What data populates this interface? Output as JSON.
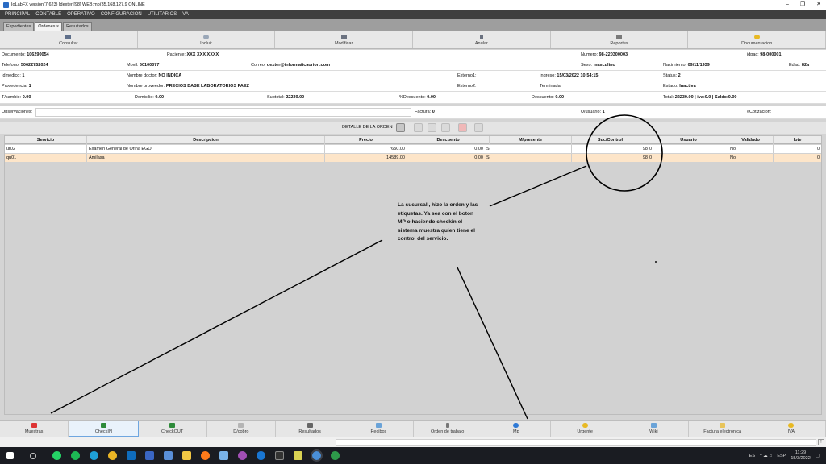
{
  "window": {
    "title": "IoLabFX version(7.623)  [dexter][98] WEB:mp(35.168.127.9 ONLINE"
  },
  "menu": [
    "PRINCIPAL",
    "CONTABLE",
    "OPERATIVO",
    "CONFIGURACION",
    "UTILITARIOS",
    "VA"
  ],
  "tabs": [
    "Expedientes",
    "Ordenes ×",
    "Resultados"
  ],
  "toolbar": [
    {
      "label": "Consultar",
      "icon": "binoculars-icon",
      "color": "#5f6f8a"
    },
    {
      "label": "Incluir",
      "icon": "sun-icon",
      "color": "#9aa7b8"
    },
    {
      "label": "Modificar",
      "icon": "edit-icon",
      "color": "#6b7280"
    },
    {
      "label": "Anular",
      "icon": "pen-icon",
      "color": "#6b7280"
    },
    {
      "label": "Reportes",
      "icon": "printer-icon",
      "color": "#7a7a7a"
    },
    {
      "label": "Documentacion",
      "icon": "smiley-icon",
      "color": "#e8b923"
    }
  ],
  "info": {
    "documento_label": "Documento:",
    "documento": "106290054",
    "paciente_label": "Paciente:",
    "paciente": "XXX XXX XXXX",
    "numero_label": "Numero:",
    "numero": "98-220300003",
    "idpac_label": "idpac:",
    "idpac": "98-000001",
    "telefono_label": "Telefono:",
    "telefono": "50622752024",
    "movil_label": "Movil:",
    "movil": "60100077",
    "correo_label": "Correo:",
    "correo": "dexter@informaticaorion.com",
    "sexo_label": "Sexo:",
    "sexo": "masculino",
    "nacimiento_label": "Nacimiento:",
    "nacimiento": "09/11/1939",
    "edad_label": "Edad:",
    "edad": "82a",
    "idmedico_label": "Idmedico:",
    "idmedico": "1",
    "doctor_label": "Nombre doctor:",
    "doctor": "NO INDICA",
    "externo1_label": "Externo1:",
    "ingreso_label": "Ingreso:",
    "ingreso": "15/03/2022 10:54:15",
    "status_label": "Status:",
    "status": "2",
    "procedencia_label": "Procedencia:",
    "procedencia": "1",
    "proveedor_label": "Nombre proveedor:",
    "proveedor": "PRECIOS BASE LABORATORIOS PAEZ",
    "externo2_label": "Externo2:",
    "terminada_label": "Terminada:",
    "estado_label": "Estado:",
    "estado": "Inactiva",
    "tcambio_label": "T/cambio:",
    "tcambio": "0.00",
    "domicilio_label": "Domicilio:",
    "domicilio": "0.00",
    "subtotal_label": "Subtotal:",
    "subtotal": "22239.00",
    "pdesc_label": "%Descuento:",
    "pdesc": "0.00",
    "descuento_label": "Descuento:",
    "descuento": "0.00",
    "total_label": "Total:",
    "total": "22239.00",
    "iva": "| iva:0.0",
    "saldo": "| Saldo:0.00",
    "observaciones_label": "Observaciones:",
    "factura_label": "Factura:",
    "factura": "0",
    "uusuario_label": "U/usuario:",
    "uusuario": "1",
    "cotizacion_label": "#Cotizacion:"
  },
  "detalle": {
    "title": "DETALLE DE LA ORDEN"
  },
  "grid": {
    "headers": [
      "Servicio",
      "Descripcion",
      "Precio",
      "Descuento",
      "M/presente",
      "Suc/Control",
      "Usuario",
      "Validado",
      "lote"
    ],
    "rows": [
      [
        "ur02",
        "Examen General de Orina EGO",
        "7650.00",
        "0.00",
        "Si",
        "98",
        "0",
        "",
        "No",
        "0"
      ],
      [
        "qu01",
        "Amilasa",
        "14589.00",
        "0.00",
        "Si",
        "98",
        "0",
        "",
        "No",
        "0"
      ]
    ]
  },
  "annotation": {
    "note": "La sucursal , hizo la orden y las etiquetas. Ya sea con el boton MP o haciendo checkin el sistema muestra quien tiene el control del servicio."
  },
  "bottom": [
    {
      "label": "Muestras",
      "icon": "samples-icon",
      "color": "#d33"
    },
    {
      "label": "CheckIN",
      "icon": "arrow-left-icon",
      "color": "#2e8b3a"
    },
    {
      "label": "CheckOUT",
      "icon": "arrow-right-icon",
      "color": "#2e8b3a"
    },
    {
      "label": "D/cobro",
      "icon": "document-icon",
      "color": "#b5b5b5"
    },
    {
      "label": "Resultados",
      "icon": "results-icon",
      "color": "#666"
    },
    {
      "label": "Recibos",
      "icon": "receipt-icon",
      "color": "#6aa3d8"
    },
    {
      "label": "Orden de trabajo",
      "icon": "pen-icon",
      "color": "#777"
    },
    {
      "label": "Mp",
      "icon": "info-icon",
      "color": "#2f7ad6"
    },
    {
      "label": "Urgente",
      "icon": "smiley-icon",
      "color": "#e8b923"
    },
    {
      "label": "Wiki",
      "icon": "wiki-icon",
      "color": "#6aa3d8"
    },
    {
      "label": "Factura electronica",
      "icon": "folder-icon",
      "color": "#e8c45a"
    },
    {
      "label": "IVA",
      "icon": "sun-icon",
      "color": "#e8b923"
    }
  ],
  "status": {
    "lang": "ES",
    "keyboard": "ESP",
    "time": "11:29",
    "date": "15/3/2022"
  }
}
